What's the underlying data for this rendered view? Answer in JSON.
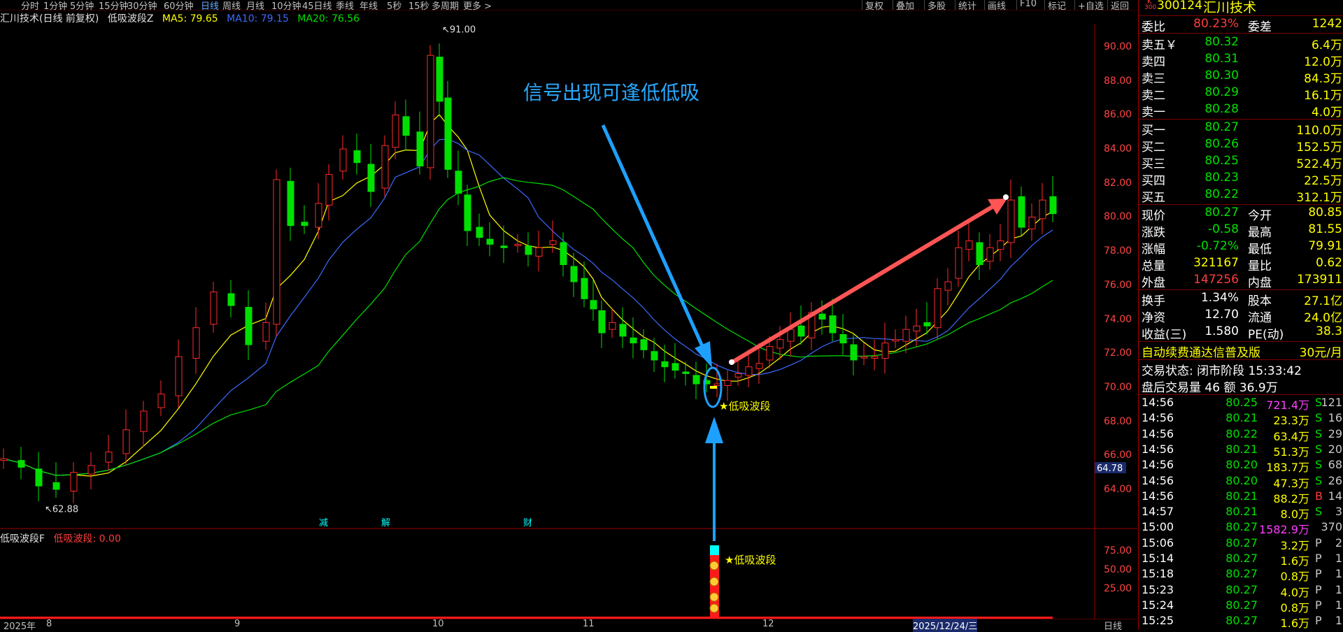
{
  "periods": [
    "分时",
    "1分钟",
    "5分钟",
    "15分钟",
    "30分钟",
    "60分钟",
    "日线",
    "周线",
    "月线",
    "10分钟",
    "45日线",
    "季线",
    "年线",
    "5秒",
    "15秒",
    "多周期",
    "更多 >"
  ],
  "active_period": "日线",
  "right_buttons": [
    "复权",
    "叠加",
    "多股",
    "统计",
    "画线",
    "F10",
    "标记",
    "+自选",
    "返回"
  ],
  "title": {
    "name": "汇川技术(日线 前复权)",
    "indicator": "低吸波段Z",
    "ma5": "MA5: 79.65",
    "ma10": "MA10: 79.15",
    "ma20": "MA20: 76.56",
    "colors": {
      "ma5": "#ffff00",
      "ma10": "#3b6bff",
      "ma20": "#00e000"
    }
  },
  "chart_data": {
    "type": "candlestick",
    "y_ticks": [
      "90.00",
      "88.00",
      "86.00",
      "84.00",
      "82.00",
      "80.00",
      "78.00",
      "76.00",
      "74.00",
      "72.00",
      "70.00",
      "68.00",
      "66.00",
      "64.00"
    ],
    "current_price_label": "64.78",
    "high_label": "91.00",
    "low_label": "62.88",
    "annotation": "信号出现可逢低低吸",
    "signal_label": "★低吸波段",
    "event_marks": [
      "减",
      "解",
      "财"
    ]
  },
  "sub_chart": {
    "name": "低吸波段F",
    "value": "低吸波段: 0.00",
    "y_ticks": [
      "75.00",
      "50.00",
      "25.00"
    ],
    "signal_label": "★低吸波段"
  },
  "date_axis": {
    "labels": [
      "2025年",
      "8",
      "9",
      "10",
      "11",
      "12"
    ],
    "cursor_date": "2025/12/24/三",
    "right_label": "日线"
  },
  "quote": {
    "k_label": "K",
    "k_sub": "300",
    "code": "300124",
    "name": "汇川技术",
    "weibi": {
      "label": "委比",
      "value": "80.23%",
      "label2": "委差",
      "value2": "1242"
    },
    "asks": [
      {
        "label": "卖五￥",
        "price": "80.32",
        "vol": "6.4万"
      },
      {
        "label": "卖四",
        "price": "80.31",
        "vol": "12.0万"
      },
      {
        "label": "卖三",
        "price": "80.30",
        "vol": "84.3万"
      },
      {
        "label": "卖二",
        "price": "80.29",
        "vol": "16.1万"
      },
      {
        "label": "卖一",
        "price": "80.28",
        "vol": "4.0万"
      }
    ],
    "bids": [
      {
        "label": "买一",
        "price": "80.27",
        "vol": "110.0万"
      },
      {
        "label": "买二",
        "price": "80.26",
        "vol": "152.5万"
      },
      {
        "label": "买三",
        "price": "80.25",
        "vol": "522.4万"
      },
      {
        "label": "买四",
        "price": "80.23",
        "vol": "22.5万"
      },
      {
        "label": "买五",
        "price": "80.22",
        "vol": "312.1万"
      }
    ],
    "stats": [
      {
        "l1": "现价",
        "v1": "80.27",
        "l2": "今开",
        "v2": "80.85",
        "c1": "green",
        "c2": "red"
      },
      {
        "l1": "涨跌",
        "v1": "-0.58",
        "l2": "最高",
        "v2": "81.55",
        "c1": "green",
        "c2": "red"
      },
      {
        "l1": "涨幅",
        "v1": "-0.72%",
        "l2": "最低",
        "v2": "79.91",
        "c1": "green",
        "c2": "green"
      },
      {
        "l1": "总量",
        "v1": "321167",
        "l2": "量比",
        "v2": "0.62",
        "c1": "yellow",
        "c2": "yellow"
      },
      {
        "l1": "外盘",
        "v1": "147256",
        "l2": "内盘",
        "v2": "173911",
        "c1": "red",
        "c2": "green"
      }
    ],
    "fund": [
      {
        "l1": "换手",
        "v1": "1.34%",
        "l2": "股本",
        "v2": "27.1亿"
      },
      {
        "l1": "净资",
        "v1": "12.70",
        "l2": "流通",
        "v2": "24.0亿"
      },
      {
        "l1": "收益(三)",
        "v1": "1.580",
        "l2": "PE(动)",
        "v2": "38.3"
      }
    ],
    "promo": "自动续费通达信普及版",
    "promo_price": "30元/月",
    "trade_state": "交易状态: 闭市阶段 15:33:42",
    "after_hours": "盘后交易量 46 额 36.9万"
  },
  "ticks": [
    {
      "t": "14:56",
      "p": "80.25",
      "v": "721.4万",
      "bs": "S",
      "n": "121",
      "pc": "green",
      "vc": "magenta"
    },
    {
      "t": "14:56",
      "p": "80.21",
      "v": "23.3万",
      "bs": "S",
      "n": "16",
      "pc": "green",
      "vc": "yellow"
    },
    {
      "t": "14:56",
      "p": "80.22",
      "v": "63.4万",
      "bs": "S",
      "n": "29",
      "pc": "green",
      "vc": "yellow"
    },
    {
      "t": "14:56",
      "p": "80.21",
      "v": "51.3万",
      "bs": "S",
      "n": "20",
      "pc": "green",
      "vc": "yellow"
    },
    {
      "t": "14:56",
      "p": "80.20",
      "v": "183.7万",
      "bs": "S",
      "n": "68",
      "pc": "green",
      "vc": "yellow"
    },
    {
      "t": "14:56",
      "p": "80.20",
      "v": "47.3万",
      "bs": "S",
      "n": "26",
      "pc": "green",
      "vc": "yellow"
    },
    {
      "t": "14:56",
      "p": "80.21",
      "v": "88.2万",
      "bs": "B",
      "n": "14",
      "pc": "green",
      "vc": "yellow"
    },
    {
      "t": "14:57",
      "p": "80.21",
      "v": "8.0万",
      "bs": "S",
      "n": "3",
      "pc": "green",
      "vc": "yellow"
    },
    {
      "t": "15:00",
      "p": "80.27",
      "v": "1582.9万",
      "bs": "",
      "n": "370",
      "pc": "green",
      "vc": "magenta"
    },
    {
      "t": "15:06",
      "p": "80.27",
      "v": "3.2万",
      "bs": "P",
      "n": "2",
      "pc": "green",
      "vc": "yellow"
    },
    {
      "t": "15:14",
      "p": "80.27",
      "v": "1.6万",
      "bs": "P",
      "n": "1",
      "pc": "green",
      "vc": "yellow"
    },
    {
      "t": "15:18",
      "p": "80.27",
      "v": "0.8万",
      "bs": "P",
      "n": "1",
      "pc": "green",
      "vc": "yellow"
    },
    {
      "t": "15:23",
      "p": "80.27",
      "v": "4.0万",
      "bs": "P",
      "n": "1",
      "pc": "green",
      "vc": "yellow"
    },
    {
      "t": "15:24",
      "p": "80.27",
      "v": "0.8万",
      "bs": "P",
      "n": "1",
      "pc": "green",
      "vc": "yellow"
    },
    {
      "t": "15:25",
      "p": "80.27",
      "v": "1.6万",
      "bs": "P",
      "n": "1",
      "pc": "green",
      "vc": "yellow"
    }
  ]
}
